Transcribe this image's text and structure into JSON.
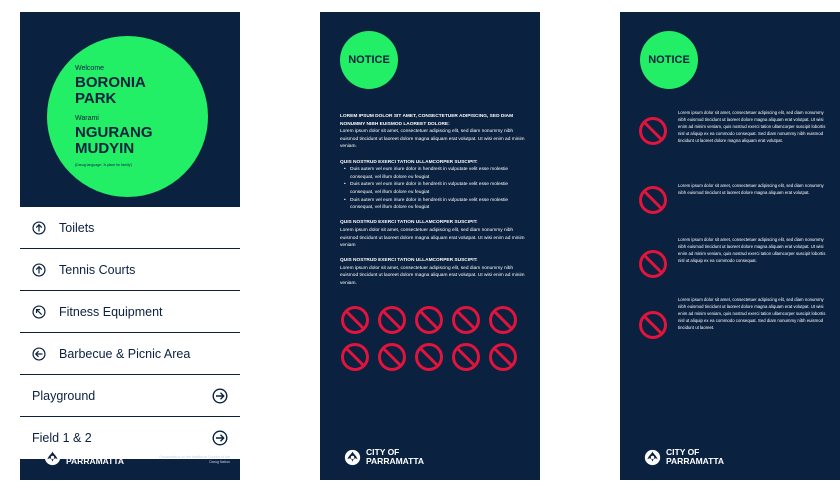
{
  "colors": {
    "navy": "#0b2140",
    "green": "#22ee66",
    "red": "#e0143c",
    "white": "#ffffff"
  },
  "panel1": {
    "welcome": "Welcome",
    "park_name": "BORONIA PARK",
    "warami": "Warami",
    "indigenous_name": "NGURANG MUDYIN",
    "language_note": "(Darug language: 'A place for family')",
    "items": [
      {
        "label": "Toilets",
        "icon": "arrow-up-circle-icon"
      },
      {
        "label": "Tennis Courts",
        "icon": "arrow-up-circle-icon"
      },
      {
        "label": "Fitness Equipment",
        "icon": "arrow-up-left-circle-icon"
      },
      {
        "label": "Barbecue & Picnic Area",
        "icon": "arrow-left-circle-icon"
      },
      {
        "label": "Playground",
        "icon": "arrow-right-circle-icon"
      },
      {
        "label": "Field 1 & 2",
        "icon": "arrow-right-circle-icon"
      }
    ],
    "footer_note": "Parramatta is on the traditional Country of the Darug Nation"
  },
  "logo": {
    "line1": "CITY OF",
    "line2": "PARRAMATTA"
  },
  "notice": {
    "label": "NOTICE"
  },
  "panel2": {
    "intro_heading": "LOREM IPSUM DOLOR SIT AMET, CONSECTETUER ADIPISCING, SED DIAM NONUMMY NIBH EUISMOD LAOREET DOLORE:",
    "intro_text": "Lorem ipsum dolor sit amet, consectetuer adipiscing elit, sed diam nonummy nibh euismod tincidunt ut laoreet dolore magna aliquam erat volutpat. Ut wisi enim ad minim veniam.",
    "section2_heading": "QUIS NOSTRUD EXERCI TATION ULLAMCORPER SUSCIPIT:",
    "bullets": [
      "Duis autem vel eum iriure dolor in hendrerit in vulputate velit esse molestie consequat, vel illum dolore eu feugiat",
      "Duis autem vel eum iriure dolor in hendrerit in vulputate velit esse molestie consequat, vel illum dolore eu feugiat",
      "Duis autem vel eum iriure dolor in hendrerit in vulputate velit esse molestie consequat, vel illum dolore eu feugiat"
    ],
    "section3_heading": "QUIS NOSTRUD EXERCI TATION ULLAMCORPER SUSCIPIT:",
    "section3_text": "Lorem ipsum dolor sit amet, consectetuer adipiscing elit, sed diam nonummy nibh euismod tincidunt ut laoreet dolore magna aliquam erat volutpat. Ut wisi enim ad minim veniam",
    "section4_heading": "QUIS NOSTRUD EXERCI TATION ULLAMCORPER SUSCIPIT:",
    "section4_text": "Lorem ipsum dolor sit amet, consectetuer adipiscing elit, sed diam nonummy nibh euismod tincidunt ut laoreet dolore magna aliquam erat volutpat. Ut wisi enim ad minim veniam.",
    "prohibition_icon": "no-entry-icon",
    "prohibition_count": 10
  },
  "panel3": {
    "notices": [
      {
        "icon": "no-entry-icon",
        "text": "Lorem ipsum dolor sit amet, consectetuer adipiscing elit, sed diam nonummy nibh euismod tincidunt ut laoreet dolore magna aliquam erat volutpat. Ut wisi enim ad minim veniam, quis nostrud exerci tation ullamcorper suscipit lobortis nisl ut aliquip ex ea commodo consequat. Sed diam nonummy nibh euismod tincidunt ut laoreet dolore magna aliquam erat volutpat."
      },
      {
        "icon": "no-entry-icon",
        "text": "Lorem ipsum dolor sit amet, consectetuer adipiscing elit, sed diam nonummy nibh euismod tincidunt ut laoreet dolore magna aliquam erat volutpat."
      },
      {
        "icon": "no-entry-icon",
        "text": "Lorem ipsum dolor sit amet, consectetuer adipiscing elit, sed diam nonummy nibh euismod tincidunt ut laoreet dolore magna aliquam erat volutpat. Ut wisi enim ad minim veniam, quis nostrud exerci tation ullamcorper suscipit lobortis nisl ut aliquip ex ea commodo consequat."
      },
      {
        "icon": "no-entry-icon",
        "text": "Lorem ipsum dolor sit amet, consectetuer adipiscing elit, sed diam nonummy nibh euismod tincidunt ut laoreet dolore magna aliquam erat volutpat. Ut wisi enim ad minim veniam, quis nostrud exerci tation ullamcorper suscipit lobortis nisl ut aliquip ex ea commodo consequat. Sed diam nonummy nibh euismod tincidunt ut laoreet."
      }
    ]
  }
}
